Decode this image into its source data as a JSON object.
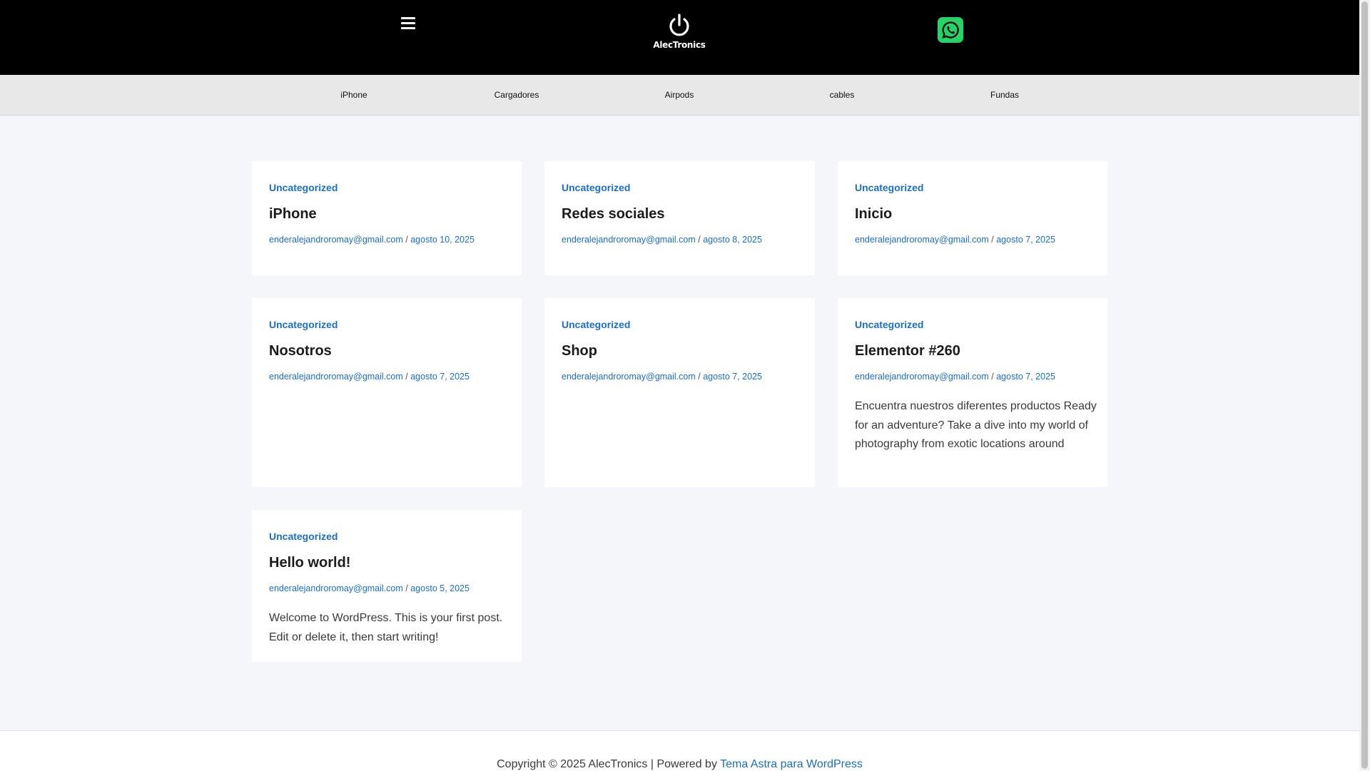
{
  "header": {
    "logo_text": "AlecTronics"
  },
  "nav": [
    {
      "label": "iPhone"
    },
    {
      "label": "Cargadores"
    },
    {
      "label": "Airpods"
    },
    {
      "label": "cables"
    },
    {
      "label": "Fundas"
    }
  ],
  "posts": [
    {
      "category": "Uncategorized",
      "title": "iPhone",
      "author": "enderalejandroromay@gmail.com",
      "separator": "/",
      "date": "agosto 10, 2025",
      "excerpt": ""
    },
    {
      "category": "Uncategorized",
      "title": "Redes sociales",
      "author": "enderalejandroromay@gmail.com",
      "separator": "/",
      "date": "agosto 8, 2025",
      "excerpt": ""
    },
    {
      "category": "Uncategorized",
      "title": "Inicio",
      "author": "enderalejandroromay@gmail.com",
      "separator": "/",
      "date": "agosto 7, 2025",
      "excerpt": ""
    },
    {
      "category": "Uncategorized",
      "title": "Nosotros",
      "author": "enderalejandroromay@gmail.com",
      "separator": "/",
      "date": "agosto 7, 2025",
      "excerpt": ""
    },
    {
      "category": "Uncategorized",
      "title": "Shop",
      "author": "enderalejandroromay@gmail.com",
      "separator": "/",
      "date": "agosto 7, 2025",
      "excerpt": ""
    },
    {
      "category": "Uncategorized",
      "title": "Elementor #260",
      "author": "enderalejandroromay@gmail.com",
      "separator": "/",
      "date": "agosto 7, 2025",
      "excerpt": "Encuentra nuestros diferentes productos Ready for an adventure? Take a dive into my world of photography from exotic locations around"
    },
    {
      "category": "Uncategorized",
      "title": "Hello world!",
      "author": "enderalejandroromay@gmail.com",
      "separator": "/",
      "date": "agosto 5, 2025",
      "excerpt": "Welcome to WordPress. This is your first post. Edit or delete it, then start writing!"
    }
  ],
  "footer": {
    "copyright": "Copyright © 2025 AlecTronics | Powered by ",
    "link": "Tema Astra para WordPress"
  },
  "colors": {
    "header_bg": "#000000",
    "nav_bg": "#e8e8e8",
    "link": "#1a6fc4",
    "whatsapp": "#25d366",
    "page_bg": "#f5f6fa"
  }
}
